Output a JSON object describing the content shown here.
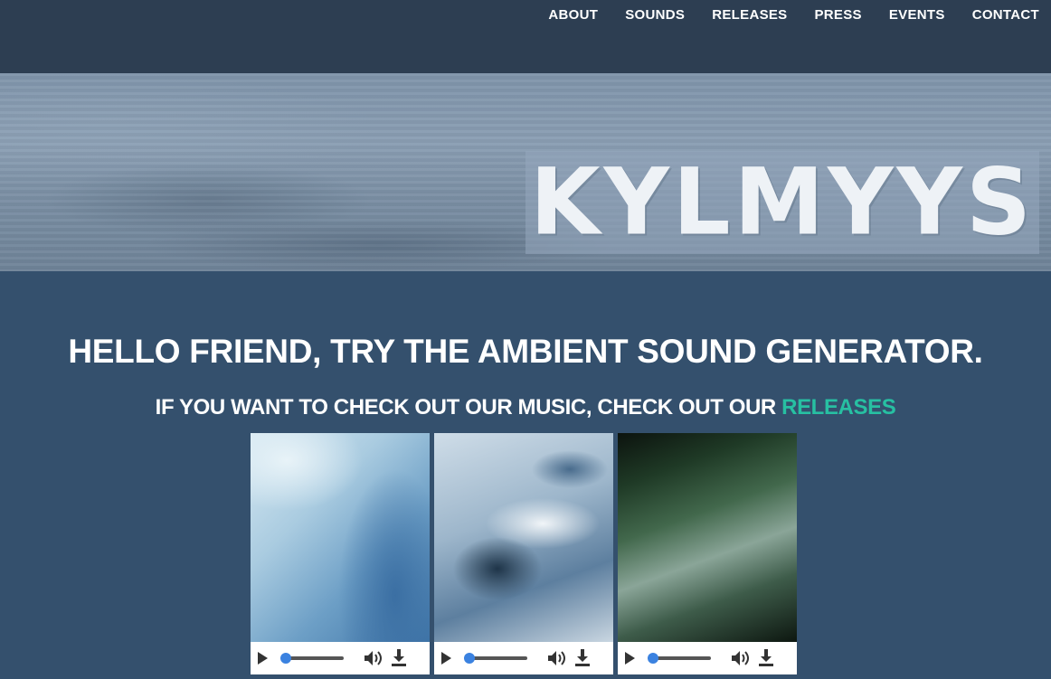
{
  "nav": {
    "items": [
      {
        "label": "ABOUT"
      },
      {
        "label": "SOUNDS"
      },
      {
        "label": "RELEASES"
      },
      {
        "label": "PRESS"
      },
      {
        "label": "EVENTS"
      },
      {
        "label": "CONTACT"
      }
    ]
  },
  "hero": {
    "logo_text": "KYLMYYS"
  },
  "main": {
    "headline": "HELLO FRIEND, TRY THE AMBIENT SOUND GENERATOR.",
    "subline_prefix": "IF YOU WANT TO CHECK OUT OUR MUSIC, CHECK OUT OUR ",
    "subline_link": "RELEASES"
  },
  "players": [
    {
      "icons": [
        "play-icon",
        "volume-icon",
        "download-icon"
      ],
      "progress": 0
    },
    {
      "icons": [
        "play-icon",
        "volume-icon",
        "download-icon"
      ],
      "progress": 0
    },
    {
      "icons": [
        "play-icon",
        "volume-icon",
        "download-icon"
      ],
      "progress": 0
    }
  ],
  "colors": {
    "nav_bg": "#2d3e52",
    "page_bg": "#34506d",
    "link_accent": "#27c0a2",
    "seek_knob": "#3b82e0"
  }
}
